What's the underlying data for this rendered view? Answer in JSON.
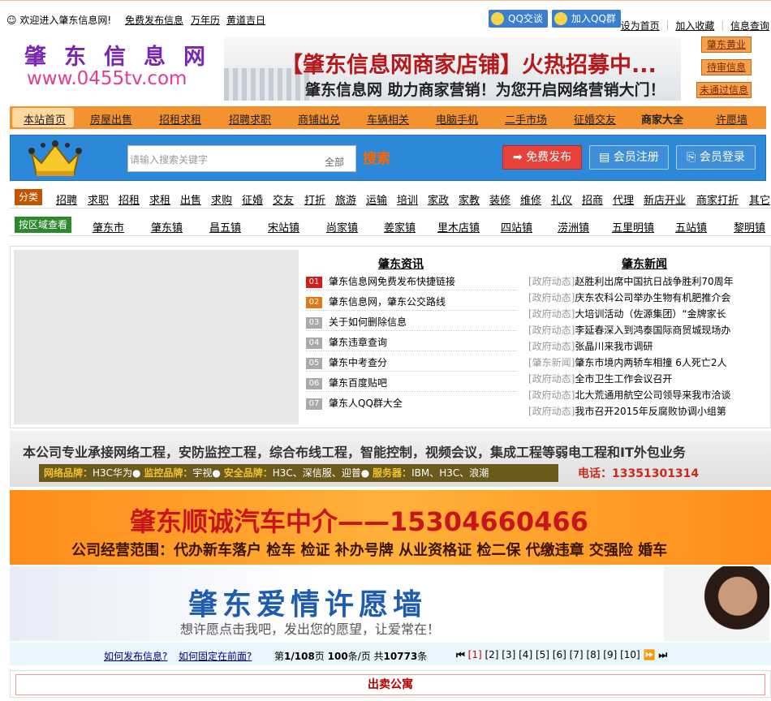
{
  "topbar": {
    "welcome": "☺ 欢迎进入肇东信息网!",
    "links": [
      "免费发布信息",
      "万年历",
      "黄道吉日"
    ],
    "qq_chat": "QQ交谈",
    "qq_group": "加入QQ群",
    "right_links": [
      "设为首页",
      "加入收藏",
      "信息查询"
    ]
  },
  "logo": {
    "title": "肇东信息网",
    "url": "www.0455tv.com"
  },
  "banner": {
    "headline": "【肇东信息网商家店铺】火热招募中...",
    "sub": "肇东信息网 助力商家营销！为您开启网络营销大门！"
  },
  "side_buttons": [
    "肇东黄业",
    "待审信息",
    "未通过信息"
  ],
  "nav": [
    "本站首页",
    "房屋出售",
    "招租求租",
    "招聘求职",
    "商铺出兑",
    "车辆相关",
    "电脑手机",
    "二手市场",
    "征婚交友",
    "商家大全",
    "许愿墙"
  ],
  "search": {
    "placeholder": "请输入搜索关键字",
    "scope": "全部",
    "button": "搜索",
    "publish": "免费发布",
    "register": "会员注册",
    "login": "会员登录"
  },
  "categories": {
    "tag": "分类",
    "items": [
      "招聘",
      "求职",
      "招租",
      "求租",
      "出售",
      "求购",
      "征婚",
      "交友",
      "打折",
      "旅游",
      "运输",
      "培训",
      "家政",
      "家教",
      "装修",
      "维修",
      "礼仪",
      "招商",
      "代理",
      "新店开业",
      "商家打折",
      "其它"
    ]
  },
  "regions": {
    "tag": "按区域查看",
    "items": [
      "肇东市",
      "肇东镇",
      "昌五镇",
      "宋站镇",
      "尚家镇",
      "姜家镇",
      "里木店镇",
      "四站镇",
      "涝洲镇",
      "五里明镇",
      "五站镇",
      "黎明镇"
    ]
  },
  "info": {
    "title": "肇东资讯",
    "items": [
      {
        "num": "01",
        "text": "肇东信息网免费发布快捷链接"
      },
      {
        "num": "02",
        "text": "肇东信息网，肇东公交路线"
      },
      {
        "num": "03",
        "text": "关于如何删除信息"
      },
      {
        "num": "04",
        "text": "肇东违章查询"
      },
      {
        "num": "05",
        "text": "肇东中考查分"
      },
      {
        "num": "06",
        "text": "肇东百度贴吧"
      },
      {
        "num": "07",
        "text": "肇东人QQ群大全"
      }
    ]
  },
  "news": {
    "title": "肇东新闻",
    "items": [
      {
        "tag": "[政府动态]",
        "text": "赵胜利出席中国抗日战争胜利70周年"
      },
      {
        "tag": "[政府动态]",
        "text": "庆东农科公司举办生物有机肥推介会"
      },
      {
        "tag": "[政府动态]",
        "text": "大培训活动（佐源集团）“金牌家长"
      },
      {
        "tag": "[政府动态]",
        "text": "李延春深入到鸿泰国际商贸城现场办"
      },
      {
        "tag": "[政府动态]",
        "text": "张晶川来我市调研"
      },
      {
        "tag": "[肇东新闻]",
        "text": "肇东市境内两轿车相撞 6人死亡2人"
      },
      {
        "tag": "[政府动态]",
        "text": "全市卫生工作会议召开"
      },
      {
        "tag": "[政府动态]",
        "text": "北大荒通用航空公司领导来我市洽谈"
      },
      {
        "tag": "[政府动态]",
        "text": "我市召开2015年反腐败协调小组第"
      }
    ]
  },
  "ad1": {
    "line1": "本公司专业承接网络工程，安防监控工程，综合布线工程，智能控制，视频会议，集成工程等弱电工程和IT外包业务",
    "brands": [
      {
        "k": "网络品牌：",
        "v": "H3C华为●"
      },
      {
        "k": "监控品牌：",
        "v": "宇视●"
      },
      {
        "k": "安全品牌：",
        "v": "H3C、深信服、迎普●"
      },
      {
        "k": "服务器：",
        "v": "IBM、H3C、浪潮"
      }
    ],
    "tel": "电话：13351301314"
  },
  "ad2": {
    "title": "肇东顺诚汽车中介——15304660466",
    "sub": "公司经营范围：代办新车落户 检车 检证 补办号牌 从业资格证 检二保 代缴违章 交强险 婚车"
  },
  "ad3": {
    "title": "肇东爱情许愿墙",
    "sub": "想许愿点击我吧，发出您的愿望，让爱常在！"
  },
  "pager": {
    "how_publish": "如何发布信息?",
    "how_fix": "如何固定在前面?",
    "page": "1/108",
    "per_page": "100",
    "total": "10773",
    "pages": [
      "[1]",
      "[2]",
      "[3]",
      "[4]",
      "[5]",
      "[6]",
      "[7]",
      "[8]",
      "[9]",
      "[10]"
    ]
  },
  "section": {
    "title": "出卖公寓"
  }
}
